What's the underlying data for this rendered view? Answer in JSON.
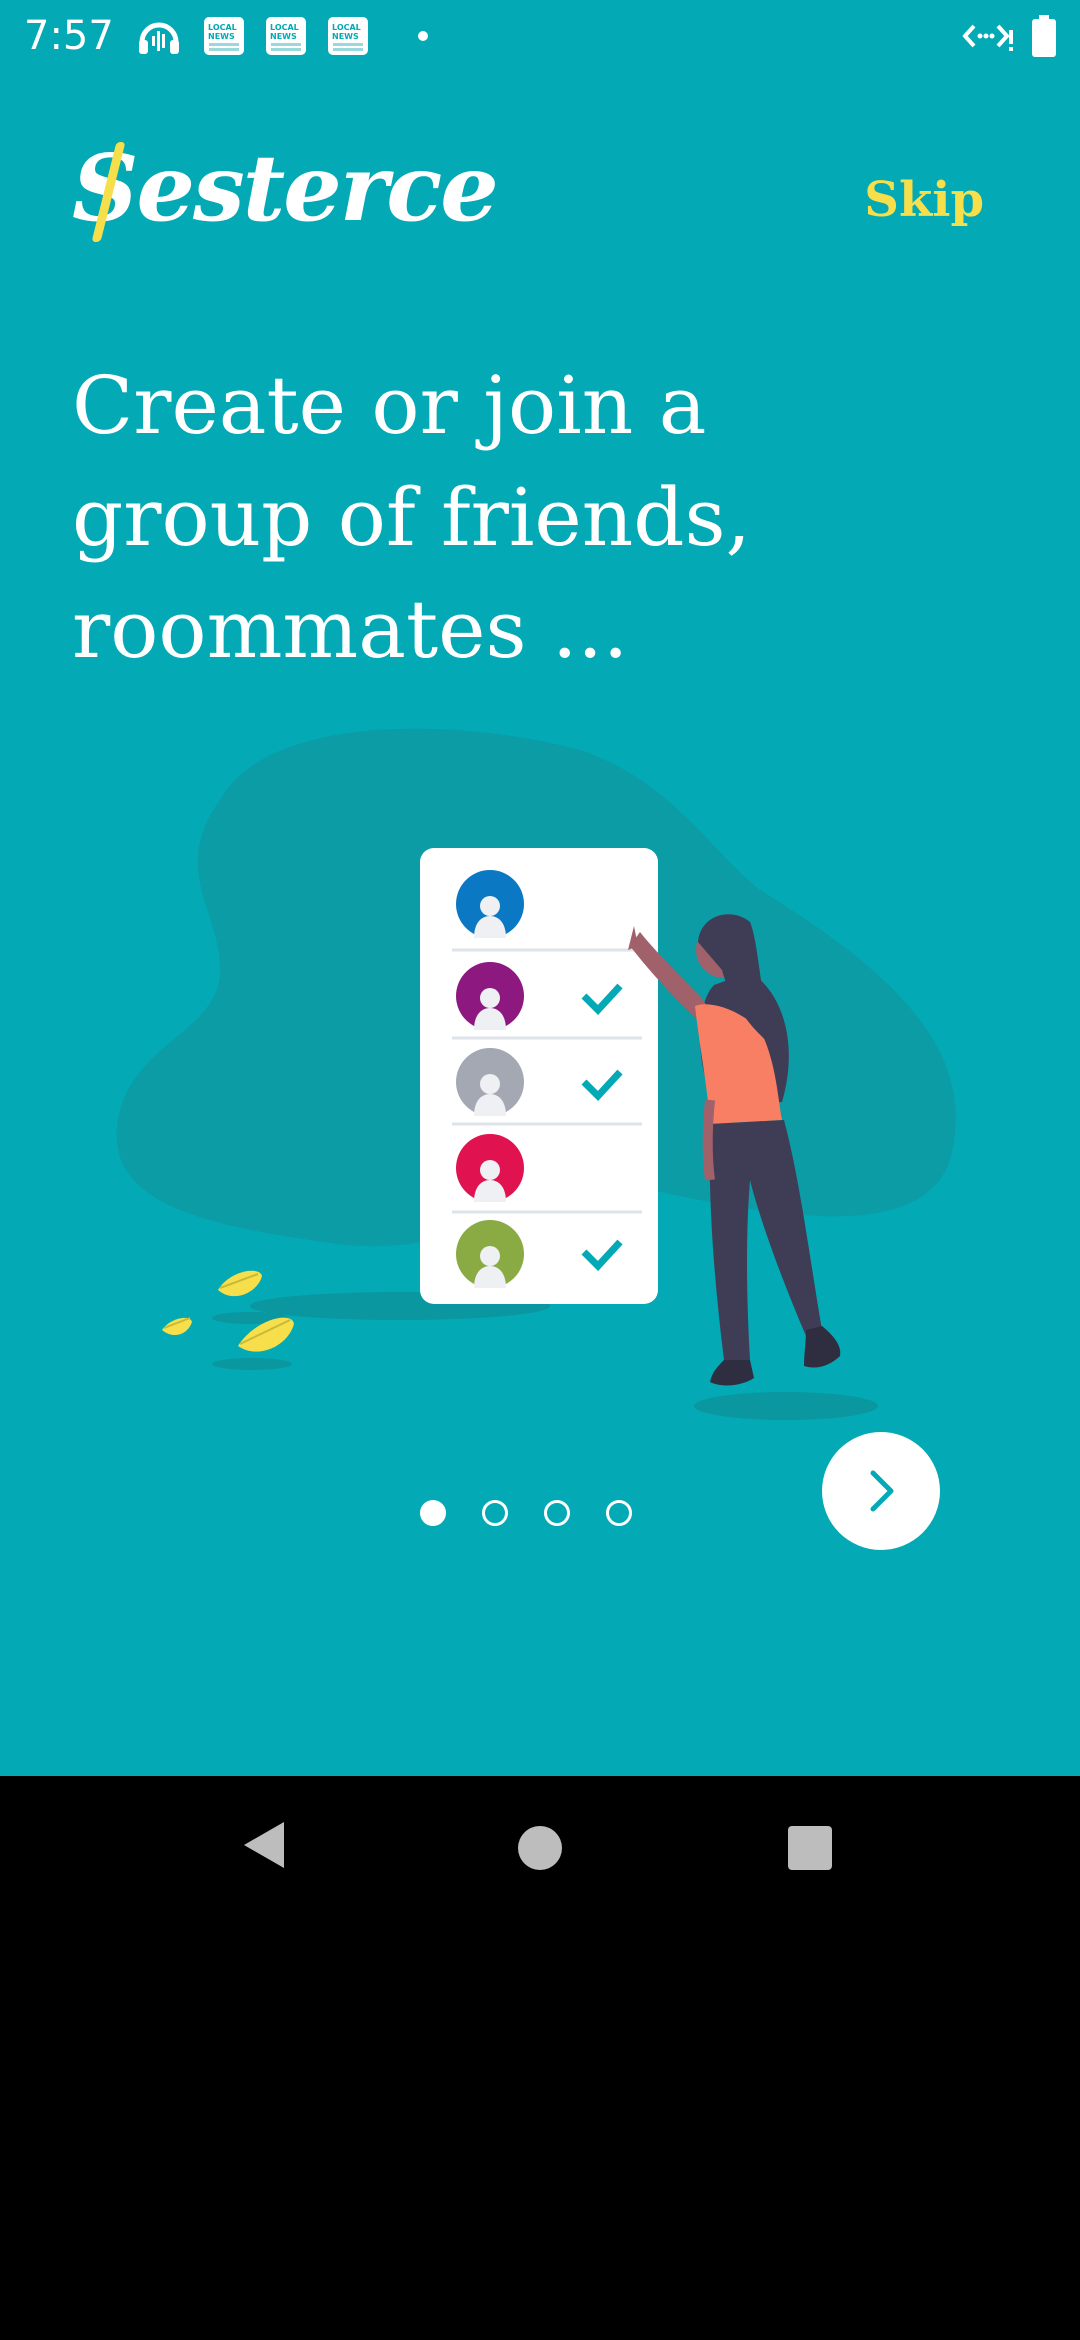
{
  "status_bar": {
    "time": "7:57",
    "left_icons": [
      "podcast-icon",
      "news-icon",
      "news-icon",
      "news-icon",
      "dot-icon"
    ],
    "news_label": "LOCAL NEWS",
    "right_icons": [
      "data-saver-icon",
      "battery-icon"
    ]
  },
  "header": {
    "logo_text": "Sesterce",
    "skip_label": "Skip"
  },
  "onboarding": {
    "headline_lines": [
      "Create or join a",
      "group of friends,",
      "roommates ..."
    ],
    "page_index": 1,
    "page_count": 4
  },
  "illustration": {
    "members": [
      {
        "color": "#0a78c2",
        "checked": false
      },
      {
        "color": "#8c1880",
        "checked": true
      },
      {
        "color": "#a3a8b2",
        "checked": true
      },
      {
        "color": "#e0124f",
        "checked": false
      },
      {
        "color": "#8aab44",
        "checked": true
      }
    ]
  },
  "colors": {
    "background": "#03a9b4",
    "accent": "#f6df4b",
    "blob": "#0b9ca6"
  },
  "nav_bar": {
    "buttons": [
      "back-icon",
      "home-icon",
      "recents-icon"
    ]
  }
}
